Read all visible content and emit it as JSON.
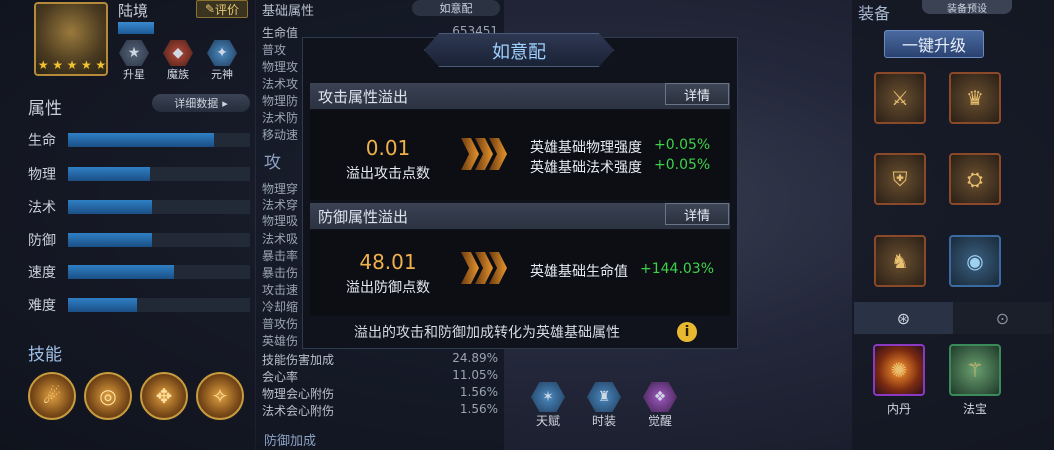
{
  "hero": {
    "name": "陆境",
    "eval_label": "评价",
    "stars": 5,
    "buttons": [
      {
        "label": "升星",
        "icon": "star-icon"
      },
      {
        "label": "魔族",
        "icon": "demon-icon"
      },
      {
        "label": "元神",
        "icon": "spirit-icon"
      }
    ]
  },
  "attributes": {
    "title": "属性",
    "detail_label": "详细数据",
    "rows": [
      {
        "label": "生命",
        "level": 0.8
      },
      {
        "label": "物理",
        "level": 0.45
      },
      {
        "label": "法术",
        "level": 0.46
      },
      {
        "label": "防御",
        "level": 0.46
      },
      {
        "label": "速度",
        "level": 0.58
      },
      {
        "label": "难度",
        "level": 0.38
      }
    ]
  },
  "skills": {
    "title": "技能",
    "count": 4
  },
  "base_stats": {
    "title": "基础属性",
    "button_label": "如意配",
    "rows": [
      {
        "label": "生命值",
        "value": "653451"
      },
      {
        "label": "普攻",
        "value": ""
      },
      {
        "label": "物理攻",
        "value": ""
      },
      {
        "label": "法术攻",
        "value": ""
      },
      {
        "label": "物理防",
        "value": ""
      },
      {
        "label": "法术防",
        "value": ""
      },
      {
        "label": "移动速",
        "value": ""
      }
    ],
    "attack_title": "攻",
    "attack_rows": [
      {
        "label": "物理穿",
        "value": ""
      },
      {
        "label": "法术穿",
        "value": ""
      },
      {
        "label": "物理吸",
        "value": ""
      },
      {
        "label": "法术吸",
        "value": ""
      },
      {
        "label": "暴击率",
        "value": ""
      },
      {
        "label": "暴击伤",
        "value": ""
      },
      {
        "label": "攻击速",
        "value": ""
      },
      {
        "label": "冷却缩",
        "value": ""
      },
      {
        "label": "普攻伤",
        "value": ""
      },
      {
        "label": "英雄伤",
        "value": ""
      },
      {
        "label": "技能伤害加成",
        "value": "24.89%"
      },
      {
        "label": "会心率",
        "value": "11.05%"
      },
      {
        "label": "物理会心附伤",
        "value": "1.56%"
      },
      {
        "label": "法术会心附伤",
        "value": "1.56%"
      }
    ],
    "defense_title": "防御加成"
  },
  "bottom_nav": [
    {
      "label": "天赋",
      "icon": "talent-icon"
    },
    {
      "label": "时装",
      "icon": "fashion-icon"
    },
    {
      "label": "觉醒",
      "icon": "awaken-icon"
    }
  ],
  "equipment": {
    "title": "装备",
    "preset_label": "装备预设",
    "upgrade_label": "一键升级",
    "tabs": [
      {
        "icon": "ring-icon",
        "active": true
      },
      {
        "icon": "compass-icon",
        "active": false
      }
    ],
    "bottom": [
      {
        "label": "内丹"
      },
      {
        "label": "法宝"
      }
    ]
  },
  "modal": {
    "title": "如意配",
    "attack": {
      "header": "攻击属性溢出",
      "detail_label": "详情",
      "value": "0.01",
      "caption": "溢出攻击点数",
      "bonuses": [
        {
          "name": "英雄基础物理强度",
          "value": "+0.05%"
        },
        {
          "name": "英雄基础法术强度",
          "value": "+0.05%"
        }
      ]
    },
    "defense": {
      "header": "防御属性溢出",
      "detail_label": "详情",
      "value": "48.01",
      "caption": "溢出防御点数",
      "bonuses": [
        {
          "name": "英雄基础生命值",
          "value": "+144.03%"
        }
      ]
    },
    "footer": "溢出的攻击和防御加成转化为英雄基础属性",
    "colors": {
      "number": "#f0b04a",
      "bonus": "#3ed24a",
      "title": "#9fd2ff"
    }
  }
}
